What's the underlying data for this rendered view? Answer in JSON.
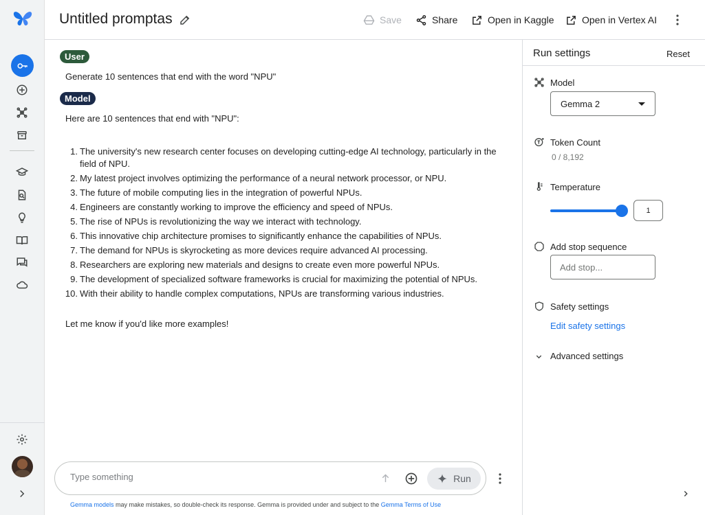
{
  "header": {
    "title": "Untitled promptas",
    "save_label": "Save",
    "share_label": "Share",
    "kaggle_label": "Open in Kaggle",
    "vertex_label": "Open in Vertex AI"
  },
  "rail": {
    "items": [
      "key-icon",
      "add-circle-icon",
      "model-icon",
      "archive-icon",
      "school-icon",
      "search-doc-icon",
      "lightbulb-icon",
      "book-icon",
      "chat-icon",
      "cloud-icon",
      "gear-icon"
    ]
  },
  "chat": {
    "user_chip": "User",
    "user_message": "Generate 10 sentences that end with the word \"NPU\"",
    "model_chip": "Model",
    "model_intro": "Here are 10 sentences that end with \"NPU\":",
    "items": [
      {
        "num": "1.",
        "text": "The university's new research center focuses on developing cutting-edge AI technology, particularly in the field of NPU."
      },
      {
        "num": "2.",
        "text": "My latest project involves optimizing the performance of a neural network processor, or NPU."
      },
      {
        "num": "3.",
        "text": "The future of mobile computing lies in the integration of powerful NPUs."
      },
      {
        "num": "4.",
        "text": "Engineers are constantly working to improve the efficiency and speed of NPUs."
      },
      {
        "num": "5.",
        "text": "The rise of NPUs is revolutionizing the way we interact with technology."
      },
      {
        "num": "6.",
        "text": "This innovative chip architecture promises to significantly enhance the capabilities of NPUs."
      },
      {
        "num": "7.",
        "text": "The demand for NPUs is skyrocketing as more devices require advanced AI processing."
      },
      {
        "num": "8.",
        "text": "Researchers are exploring new materials and designs to create even more powerful NPUs."
      },
      {
        "num": "9.",
        "text": "The development of specialized software frameworks is crucial for maximizing the potential of NPUs."
      },
      {
        "num": "10.",
        "text": "With their ability to handle complex computations, NPUs are transforming various industries."
      }
    ],
    "model_outro": "Let me know if you'd like more examples!"
  },
  "composer": {
    "placeholder": "Type something",
    "run_label": "Run",
    "disclaimer_link1": "Gemma models",
    "disclaimer_mid": " may make mistakes, so double-check its response. Gemma is provided under and subject to the ",
    "disclaimer_link2": "Gemma Terms of Use"
  },
  "panel": {
    "title": "Run settings",
    "reset_label": "Reset",
    "model_label": "Model",
    "model_value": "Gemma 2",
    "token_label": "Token Count",
    "token_value": "0 / 8,192",
    "temperature_label": "Temperature",
    "temperature_value": "1",
    "stop_label": "Add stop sequence",
    "stop_placeholder": "Add stop...",
    "safety_label": "Safety settings",
    "safety_link": "Edit safety settings",
    "advanced_label": "Advanced settings"
  },
  "colors": {
    "accent": "#1a73e8",
    "user_chip": "#2d5a3b",
    "model_chip": "#1b2b4a"
  }
}
